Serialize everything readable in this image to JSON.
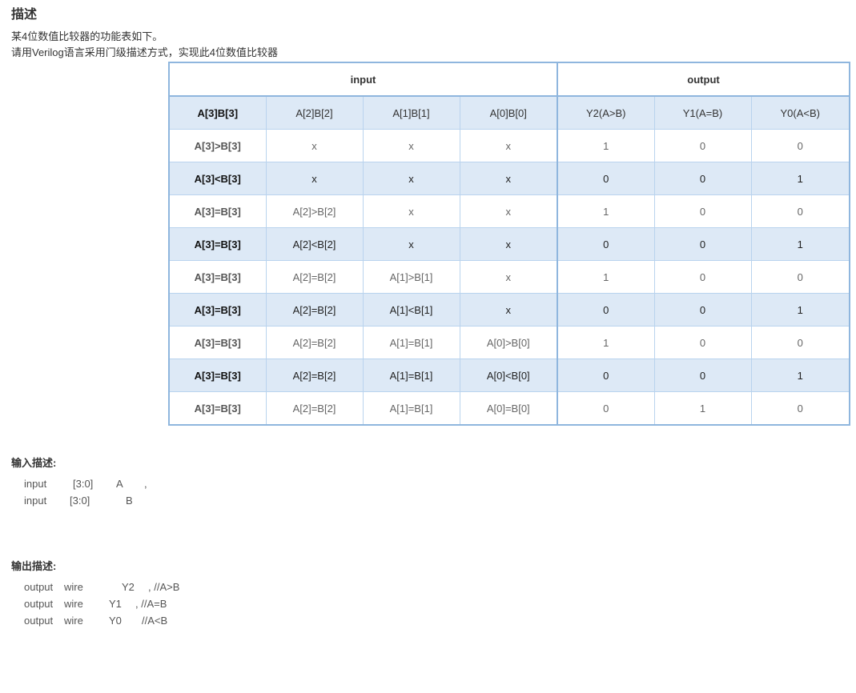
{
  "title": "描述",
  "description": [
    "某4位数值比较器的功能表如下。",
    "请用Verilog语言采用门级描述方式，实现此4位数值比较器"
  ],
  "table": {
    "groups": [
      "input",
      "output"
    ],
    "headers": [
      "A[3]B[3]",
      "A[2]B[2]",
      "A[1]B[1]",
      "A[0]B[0]",
      "Y2(A>B)",
      "Y1(A=B)",
      "Y0(A<B)"
    ],
    "rows": [
      [
        "A[3]>B[3]",
        "x",
        "x",
        "x",
        "1",
        "0",
        "0"
      ],
      [
        "A[3]<B[3]",
        "x",
        "x",
        "x",
        "0",
        "0",
        "1"
      ],
      [
        "A[3]=B[3]",
        "A[2]>B[2]",
        "x",
        "x",
        "1",
        "0",
        "0"
      ],
      [
        "A[3]=B[3]",
        "A[2]<B[2]",
        "x",
        "x",
        "0",
        "0",
        "1"
      ],
      [
        "A[3]=B[3]",
        "A[2]=B[2]",
        "A[1]>B[1]",
        "x",
        "1",
        "0",
        "0"
      ],
      [
        "A[3]=B[3]",
        "A[2]=B[2]",
        "A[1]<B[1]",
        "x",
        "0",
        "0",
        "1"
      ],
      [
        "A[3]=B[3]",
        "A[2]=B[2]",
        "A[1]=B[1]",
        "A[0]>B[0]",
        "1",
        "0",
        "0"
      ],
      [
        "A[3]=B[3]",
        "A[2]=B[2]",
        "A[1]=B[1]",
        "A[0]<B[0]",
        "0",
        "0",
        "1"
      ],
      [
        "A[3]=B[3]",
        "A[2]=B[2]",
        "A[1]=B[1]",
        "A[0]=B[0]",
        "0",
        "1",
        "0"
      ]
    ]
  },
  "input_section": {
    "title": "输入描述:",
    "lines": [
      {
        "kind": "input",
        "range": "[3:0]",
        "name": "A",
        "suffix": ","
      },
      {
        "kind": "input",
        "range": "[3:0]",
        "name": "B",
        "suffix": ""
      }
    ]
  },
  "output_section": {
    "title": "输出描述:",
    "lines": [
      {
        "kind": "output",
        "type": "wire",
        "name": "Y2",
        "comment": ", //A>B"
      },
      {
        "kind": "output",
        "type": "wire",
        "name": "Y1",
        "comment": ", //A=B"
      },
      {
        "kind": "output",
        "type": "wire",
        "name": "Y0",
        "comment": "//A<B"
      }
    ]
  },
  "colors": {
    "header_bg": "#dde9f6",
    "alt_row_bg": "#dde9f6",
    "border": "#8fb6de"
  }
}
